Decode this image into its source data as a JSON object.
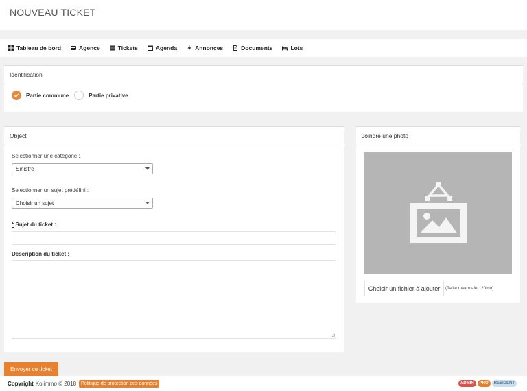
{
  "page": {
    "title": "NOUVEAU TICKET"
  },
  "nav": {
    "items": [
      {
        "label": "Tableau de bord",
        "icon": "dashboard-icon"
      },
      {
        "label": "Agence",
        "icon": "agency-icon"
      },
      {
        "label": "Tickets",
        "icon": "tickets-icon"
      },
      {
        "label": "Agenda",
        "icon": "calendar-icon"
      },
      {
        "label": "Annonces",
        "icon": "bolt-icon"
      },
      {
        "label": "Documents",
        "icon": "document-icon"
      },
      {
        "label": "Lots",
        "icon": "bed-icon"
      }
    ]
  },
  "identification": {
    "title": "Identification",
    "options": [
      {
        "label": "Partie commune",
        "checked": true
      },
      {
        "label": "Partie privative",
        "checked": false
      }
    ]
  },
  "object": {
    "title": "Object",
    "category_label": "Selectionner une catégorie :",
    "category_value": "Sinistre",
    "subject_select_label": "Selectionner un sujet prédéfini :",
    "subject_select_value": "Choisir un sujet",
    "required_mark": "*",
    "subject_label": "Sujet du ticket :",
    "subject_value": "",
    "description_label": "Description du ticket :",
    "description_value": ""
  },
  "photo": {
    "title": "Joindre une photo",
    "choose_file": "Choisir un fichier à ajouter",
    "hint": "(Taille maximale : 20mo)"
  },
  "submit_label": "Envoyer ce ticket",
  "footer": {
    "copyright": "Copyright",
    "brand": "Kolimmo © 2018",
    "policy": "Politique de protection des données",
    "badges": [
      {
        "label": "ADMIN",
        "color": "#d9534f"
      },
      {
        "label": "PRO",
        "color": "#e8812f"
      },
      {
        "label": "RESIDENT",
        "color": "#a9cbe0"
      }
    ]
  },
  "colors": {
    "accent": "#e8812f",
    "radio_on": "#e08a43",
    "photo_placeholder": "#b5b5b5"
  }
}
